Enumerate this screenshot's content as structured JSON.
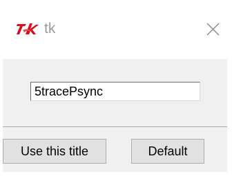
{
  "window": {
    "title": "tk",
    "icon": "tk-feather-icon",
    "close_icon": "close-icon"
  },
  "dialog": {
    "entry_value": "5tracePsync",
    "use_button_label": "Use this title",
    "default_button_label": "Default"
  },
  "colors": {
    "tk_icon_red": "#d6101a",
    "title_gray": "#9a9a9a",
    "client_bg": "#f0f0f0",
    "button_bg": "#e1e1e1"
  }
}
